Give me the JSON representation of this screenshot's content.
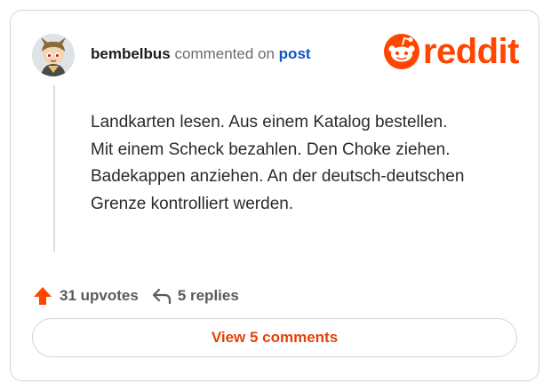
{
  "comment": {
    "author": "bembelbus",
    "action_text": "commented on",
    "target_link": "post",
    "body_lines": [
      "Landkarten lesen. Aus einem Katalog bestellen.",
      "Mit einem Scheck bezahlen. Den Choke ziehen.",
      "Badekappen anziehen. An der deutsch-deutschen",
      "Grenze kontrolliert werden."
    ]
  },
  "brand": {
    "logo_text": "reddit",
    "color": "#ff4500"
  },
  "stats": {
    "upvotes": "31 upvotes",
    "replies": "5 replies"
  },
  "actions": {
    "view_comments": "View 5 comments"
  },
  "icons": {
    "avatar": "avatar",
    "upvote": "upvote-arrow-icon",
    "reply": "reply-arrow-icon",
    "logo": "reddit-snoo-icon"
  },
  "colors": {
    "accent": "#ff4500",
    "link": "#0b58c4",
    "button_text": "#e5410a"
  }
}
